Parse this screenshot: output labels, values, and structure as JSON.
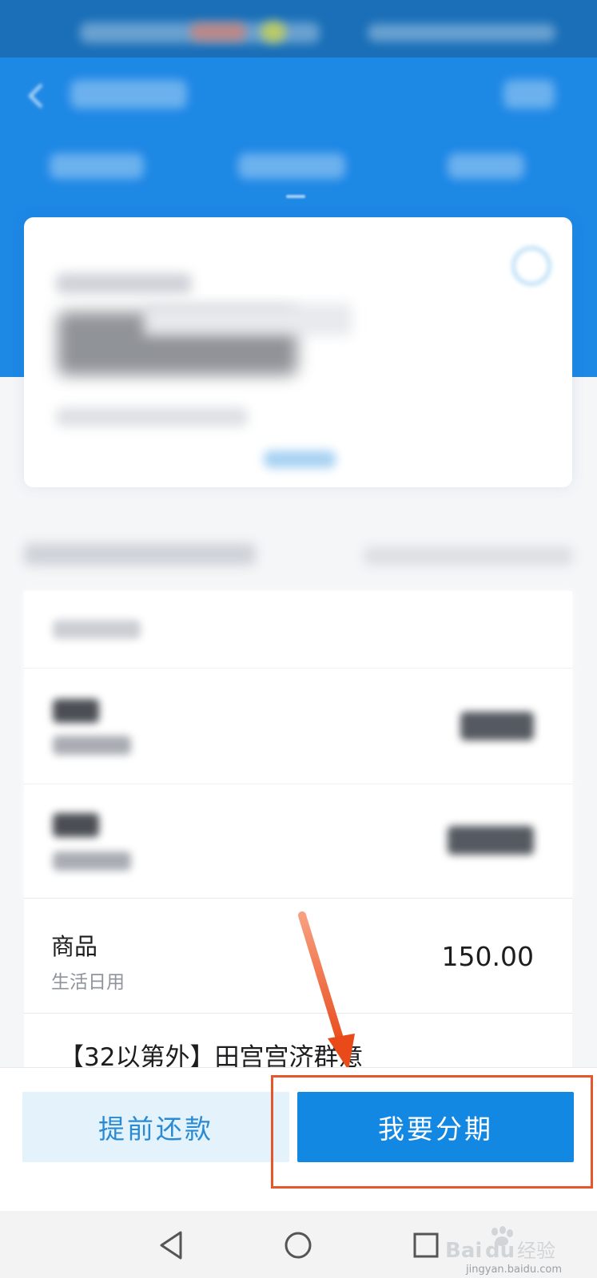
{
  "bill_rows": [
    {
      "name": "商品",
      "category": "生活日用",
      "amount": "150.00"
    }
  ],
  "partial_row_text": "【32以第外】田宫宫济群意",
  "actions": {
    "prepay_label": "提前还款",
    "installment_label": "我要分期"
  },
  "nav": {
    "back_icon": "triangle-back-icon",
    "home_icon": "circle-home-icon",
    "recents_icon": "square-recents-icon"
  },
  "watermark": {
    "logo_icon": "baidu-paw-icon",
    "brand_logo": "Bai du 经验",
    "site": "jingyan.baidu.com"
  },
  "colors": {
    "header_blue": "#1e88e5",
    "primary_button": "#1288e3",
    "secondary_button_bg": "#e3f2fb",
    "secondary_button_text": "#2a8bd4",
    "annotation_red": "#e5572a"
  }
}
